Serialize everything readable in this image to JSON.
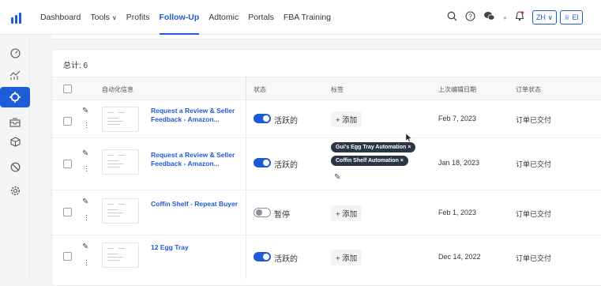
{
  "nav": {
    "items": [
      {
        "label": "Dashboard"
      },
      {
        "label": "Tools",
        "chevron": "∨"
      },
      {
        "label": "Profits"
      },
      {
        "label": "Follow-Up",
        "active": true
      },
      {
        "label": "Adtomic"
      },
      {
        "label": "Portals"
      },
      {
        "label": "FBA Training"
      }
    ],
    "lang": "ZH ∨",
    "account_btn": "El"
  },
  "sidebar_icons": [
    "dashboard-icon",
    "profits-icon",
    "follow-up-icon",
    "inbox-icon",
    "box-icon",
    "block-icon",
    "settings-icon"
  ],
  "panel": {
    "total": "总计: 6",
    "headers": {
      "automation": "自动化信息",
      "status": "状态",
      "tags": "标签",
      "last_edit": "上次编辑日期",
      "order_status": "订单状态"
    }
  },
  "rows": [
    {
      "title": "Request a Review & Seller Feedback - Amazon...",
      "status": "活跃的",
      "active": true,
      "add": "+ 添加",
      "date": "Feb 7, 2023",
      "order_status": "订单已交付"
    },
    {
      "title": "Request a Review & Seller Feedback - Amazon...",
      "status": "活跃的",
      "active": true,
      "tags": [
        "Gui's Egg Tray Automation  ×",
        "Coffin Shelf Automation  ×"
      ],
      "date": "Jan 18, 2023",
      "order_status": "订单已交付"
    },
    {
      "title": "Coffin Shelf - Repeat Buyer",
      "status": "暂停",
      "active": false,
      "add": "+ 添加",
      "date": "Feb 1, 2023",
      "order_status": "订单已交付"
    },
    {
      "title": "12 Egg Tray",
      "status": "活跃的",
      "active": true,
      "add": "+ 添加",
      "date": "Dec 14, 2022",
      "order_status": "订单已交付"
    }
  ],
  "colors": {
    "accent": "#1e5bd6",
    "tag_bg": "#2b3645"
  }
}
